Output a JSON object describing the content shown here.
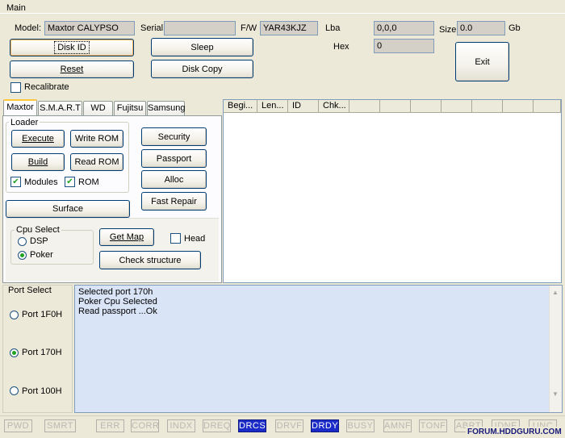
{
  "window": {
    "title": "Main"
  },
  "top": {
    "model_label": "Model:",
    "model_value": "Maxtor CALYPSO",
    "serial_label": "Serial",
    "serial_value": "",
    "fw_label": "F/W",
    "fw_value": "YAR43KJZ",
    "lba_label": "Lba",
    "lba_value": "0,0,0",
    "size_label": "Size",
    "size_value": "0.0",
    "gb_label": "Gb",
    "hex_label": "Hex",
    "hex_value": "0",
    "disk_id_button": "Disk ID",
    "sleep_button": "Sleep",
    "reset_button": "Reset",
    "disk_copy_button": "Disk Copy",
    "exit_button": "Exit",
    "recalibrate_label": "Recalibrate",
    "recalibrate_checked": false
  },
  "tabs": [
    "Maxtor",
    "S.M.A.R.T",
    "WD",
    "Fujitsu",
    "Samsung"
  ],
  "active_tab": "Maxtor",
  "maxtor": {
    "loader_title": "Loader",
    "execute_button": "Execute",
    "write_rom_button": "Write ROM",
    "build_button": "Build",
    "read_rom_button": "Read ROM",
    "modules_label": "Modules",
    "modules_checked": true,
    "rom_label": "ROM",
    "rom_checked": true,
    "security_button": "Security",
    "passport_button": "Passport",
    "alloc_button": "Alloc",
    "fast_repair_button": "Fast Repair",
    "surface_button": "Surface",
    "cpu_select_title": "Cpu Select",
    "dsp_label": "DSP",
    "poker_label": "Poker",
    "cpu_selected": "Poker",
    "get_map_button": "Get Map",
    "head_label": "Head",
    "head_checked": false,
    "check_structure_button": "Check structure"
  },
  "table": {
    "columns": [
      "Begi...",
      "Len...",
      "ID",
      "Chk...",
      "",
      "",
      "",
      "",
      "",
      "",
      ""
    ]
  },
  "port_select": {
    "title": "Port Select",
    "options": [
      "Port 1F0H",
      "Port 170H",
      "Port 100H"
    ],
    "selected": "Port 170H"
  },
  "log": {
    "lines": [
      "Selected port 170h",
      "Poker Cpu Selected",
      "Read passport ...Ok"
    ]
  },
  "status_indicators": [
    {
      "label": "PWD",
      "active": false
    },
    {
      "label": "SMRT",
      "active": false
    },
    {
      "label": "ERR",
      "active": false
    },
    {
      "label": "CORR",
      "active": false
    },
    {
      "label": "INDX",
      "active": false
    },
    {
      "label": "DREQ",
      "active": false
    },
    {
      "label": "DRCS",
      "active": true
    },
    {
      "label": "DRVF",
      "active": false
    },
    {
      "label": "DRDY",
      "active": true
    },
    {
      "label": "BUSY",
      "active": false
    },
    {
      "label": "AMNF",
      "active": false
    },
    {
      "label": "TONF",
      "active": false
    },
    {
      "label": "ABRT",
      "active": false
    },
    {
      "label": "IDNF",
      "active": false
    },
    {
      "label": "UNC",
      "active": false
    }
  ],
  "watermark": "FORUM.HDDGURU.COM",
  "colors": {
    "active_indicator": "#1B2BC8",
    "log_background": "#D9E4F6",
    "window_background": "#ECE9D8"
  }
}
